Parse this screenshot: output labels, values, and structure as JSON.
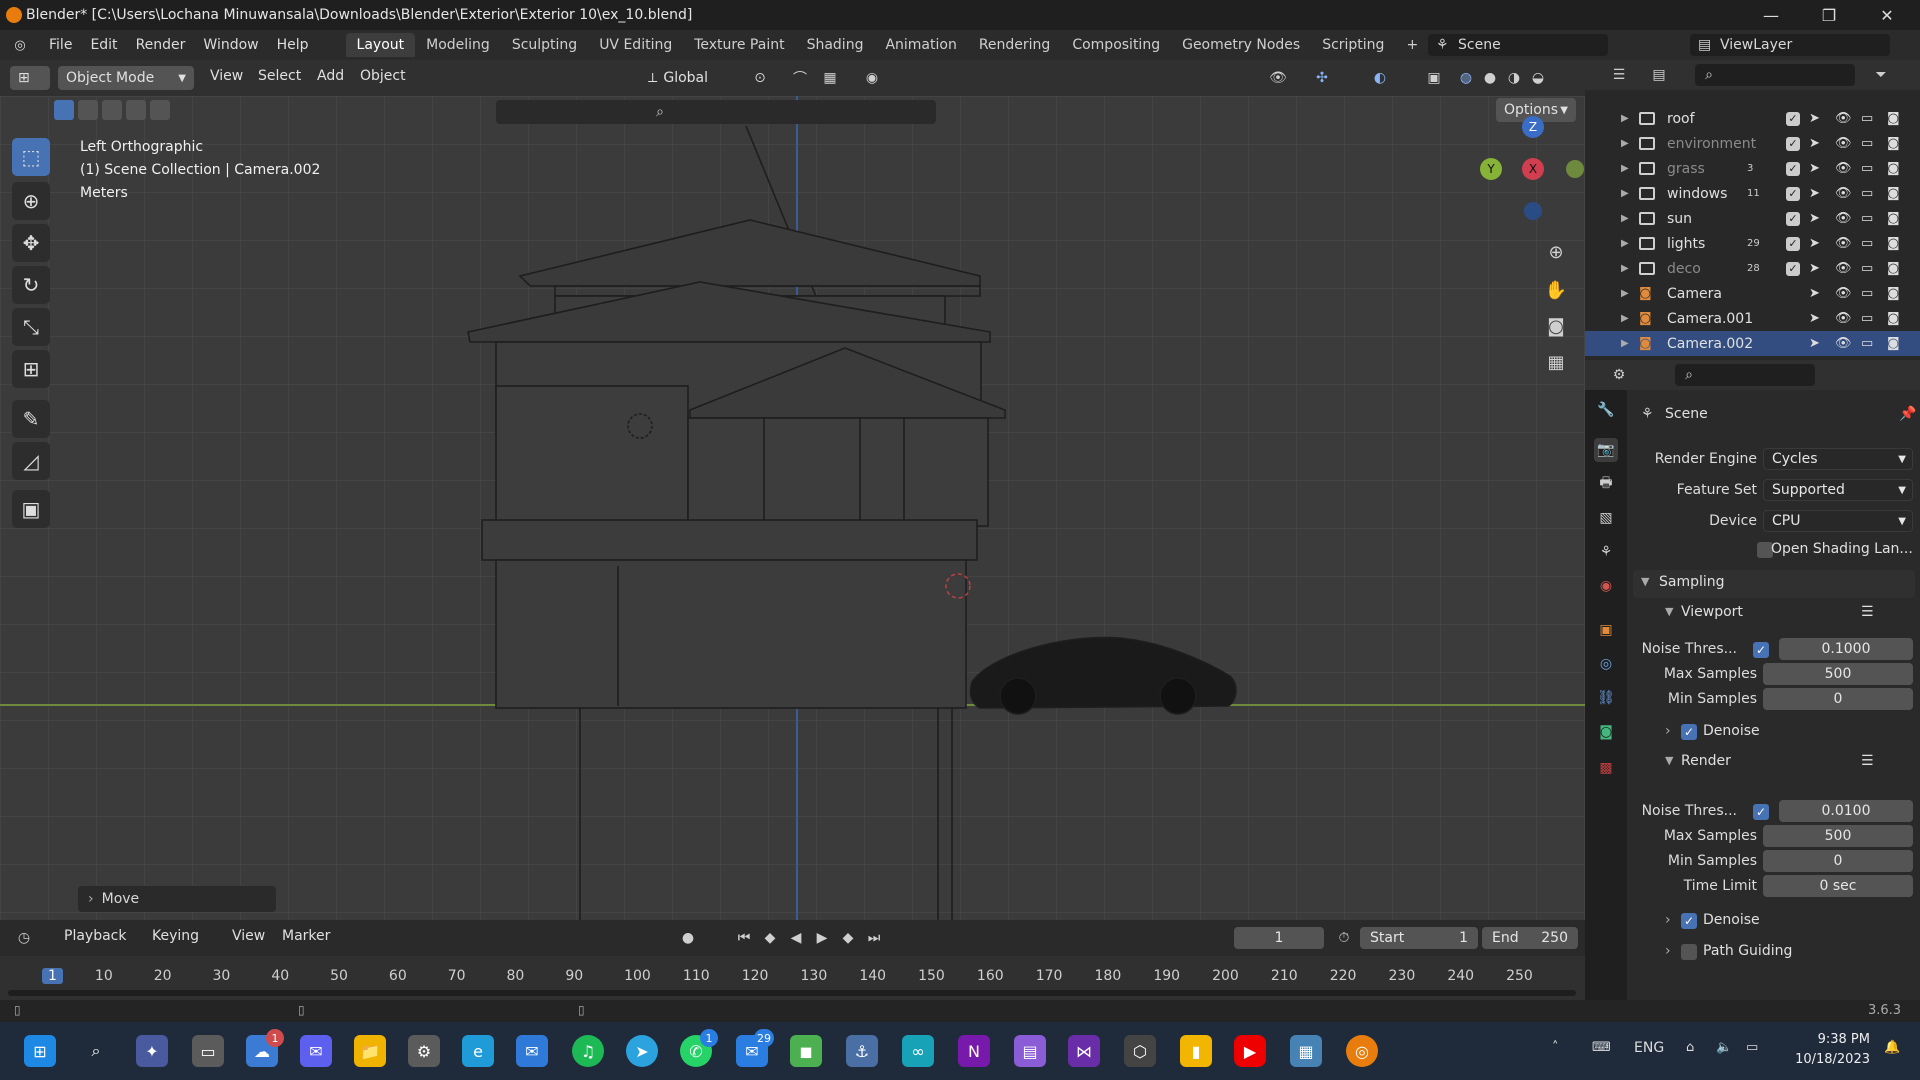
{
  "window": {
    "title": "Blender* [C:\\Users\\Lochana Minuwansala\\Downloads\\Blender\\Exterior\\Exterior 10\\ex_10.blend]",
    "minimize": "—",
    "maximize": "❐",
    "close": "✕"
  },
  "menu": [
    "File",
    "Edit",
    "Render",
    "Window",
    "Help"
  ],
  "workspaces": [
    "Layout",
    "Modeling",
    "Sculpting",
    "UV Editing",
    "Texture Paint",
    "Shading",
    "Animation",
    "Rendering",
    "Compositing",
    "Geometry Nodes",
    "Scripting"
  ],
  "workspace_add": "+",
  "scene_name": "Scene",
  "viewlayer_name": "ViewLayer",
  "viewport_header": {
    "mode": "Object Mode",
    "menus": [
      "View",
      "Select",
      "Add",
      "Object"
    ],
    "orientation": "Global",
    "options": "Options"
  },
  "viewport_overlay": {
    "view_name": "Left Orthographic",
    "collection_line": "(1) Scene Collection | Camera.002",
    "units": "Meters",
    "last_op": "Move",
    "gizmo": {
      "z": "Z",
      "y": "Y",
      "x": "X"
    }
  },
  "outliner": {
    "items": [
      {
        "name": "roof",
        "dim": false,
        "count": ""
      },
      {
        "name": "environment",
        "dim": true,
        "count": ""
      },
      {
        "name": "grass",
        "dim": true,
        "count": "3"
      },
      {
        "name": "windows",
        "dim": false,
        "count": "11"
      },
      {
        "name": "sun",
        "dim": false,
        "count": ""
      },
      {
        "name": "lights",
        "dim": false,
        "count": "29"
      },
      {
        "name": "deco",
        "dim": true,
        "count": "28"
      },
      {
        "name": "Camera",
        "dim": false,
        "count": ""
      },
      {
        "name": "Camera.001",
        "dim": false,
        "count": ""
      },
      {
        "name": "Camera.002",
        "dim": false,
        "count": "",
        "selected": true
      }
    ]
  },
  "properties": {
    "context": "Scene",
    "render_engine_label": "Render Engine",
    "render_engine": "Cycles",
    "feature_set_label": "Feature Set",
    "feature_set": "Supported",
    "device_label": "Device",
    "device": "CPU",
    "osl": "Open Shading Lan...",
    "sampling": "Sampling",
    "viewport": "Viewport",
    "noise_label": "Noise Thres...",
    "vp_noise": "0.1000",
    "max_samples_label": "Max Samples",
    "vp_max": "500",
    "min_samples_label": "Min Samples",
    "vp_min": "0",
    "denoise": "Denoise",
    "render": "Render",
    "r_noise": "0.0100",
    "r_max": "500",
    "r_min": "0",
    "time_limit_label": "Time Limit",
    "time_limit": "0 sec",
    "path_guiding": "Path Guiding"
  },
  "timeline": {
    "menus": [
      "Playback",
      "Keying",
      "View",
      "Marker"
    ],
    "current_frame": "1",
    "start_label": "Start",
    "start": "1",
    "end_label": "End",
    "end": "250",
    "ticks": [
      "1",
      "10",
      "20",
      "30",
      "40",
      "50",
      "60",
      "70",
      "80",
      "90",
      "100",
      "110",
      "120",
      "130",
      "140",
      "150",
      "160",
      "170",
      "180",
      "190",
      "200",
      "210",
      "220",
      "230",
      "240",
      "250"
    ]
  },
  "version": "3.6.3",
  "taskbar": {
    "lang": "ENG",
    "time": "9:38 PM",
    "date": "10/18/2023",
    "badges": {
      "weather": "1",
      "whatsapp": "1",
      "telegram": "29"
    }
  }
}
